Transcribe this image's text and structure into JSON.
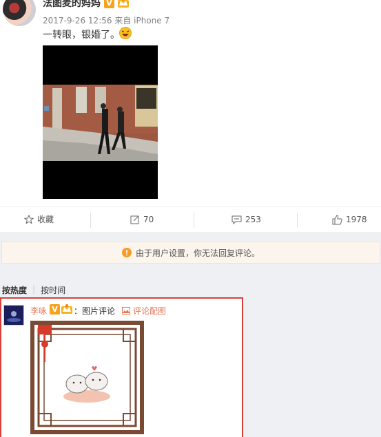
{
  "post": {
    "author": "法图麦的妈妈",
    "verified_badge": "V",
    "meta": "2017-9-26 12:56 来自 iPhone 7",
    "text": "一转眼，银婚了。",
    "emoji_icon": "laughing-emoji-icon"
  },
  "actions": {
    "favorite": "收藏",
    "repost_count": "70",
    "comment_count": "253",
    "like_count": "1978"
  },
  "notice": {
    "text": "由于用户设置，你无法回复评论。"
  },
  "sort": {
    "hot": "按热度",
    "time": "按时间"
  },
  "comment": {
    "author": "李咏",
    "verified_badge": "V",
    "text": "：图片评论",
    "image_link": "评论配图"
  },
  "colors": {
    "accent": "#eb7350",
    "badge": "#f7a41d",
    "highlight_border": "#d9403a"
  }
}
